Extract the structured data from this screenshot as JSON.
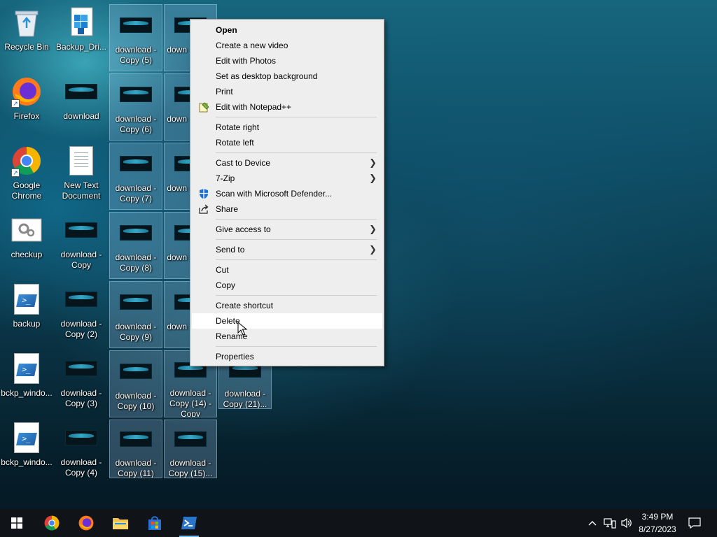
{
  "desktop": {
    "icons": [
      {
        "id": "recycle",
        "label": "Recycle Bin"
      },
      {
        "id": "backup_dr",
        "label": "Backup_Dri..."
      },
      {
        "id": "firefox",
        "label": "Firefox"
      },
      {
        "id": "download",
        "label": "download"
      },
      {
        "id": "chrome",
        "label": "Google Chrome"
      },
      {
        "id": "newtext",
        "label": "New Text Document"
      },
      {
        "id": "checkup",
        "label": "checkup"
      },
      {
        "id": "dlcopy",
        "label": "download - Copy"
      },
      {
        "id": "backup",
        "label": "backup"
      },
      {
        "id": "dlcopy2",
        "label": "download - Copy (2)"
      },
      {
        "id": "bckp1",
        "label": "bckp_windo..."
      },
      {
        "id": "dlcopy3",
        "label": "download - Copy (3)"
      },
      {
        "id": "bckp2",
        "label": "bckp_windo..."
      },
      {
        "id": "dlcopy4",
        "label": "download - Copy (4)"
      },
      {
        "id": "dlcopy5",
        "label": "download - Copy (5)"
      },
      {
        "id": "dlcopy6",
        "label": "download - Copy (6)"
      },
      {
        "id": "dlcopy7",
        "label": "download - Copy (7)"
      },
      {
        "id": "dlcopy8",
        "label": "download - Copy (8)"
      },
      {
        "id": "dlcopy9",
        "label": "download - Copy (9)"
      },
      {
        "id": "dlcopy10",
        "label": "download - Copy (10)"
      },
      {
        "id": "dlcopy11",
        "label": "download - Copy (11)"
      },
      {
        "id": "c3r1",
        "label": "down - Copy"
      },
      {
        "id": "c3r2",
        "label": "down - Copy"
      },
      {
        "id": "c3r3",
        "label": "down - Copy"
      },
      {
        "id": "c3r4",
        "label": "down - Copy"
      },
      {
        "id": "c3r5",
        "label": "down - Copy"
      },
      {
        "id": "dlcopy14",
        "label": "download - Copy (14) - Copy"
      },
      {
        "id": "dlcopy15",
        "label": "download - Copy (15)..."
      },
      {
        "id": "dlcopy21",
        "label": "download - Copy (21)..."
      }
    ]
  },
  "context_menu": {
    "items": {
      "open": "Open",
      "create_video": "Create a new video",
      "edit_photos": "Edit with Photos",
      "set_background": "Set as desktop background",
      "print": "Print",
      "edit_notepad": "Edit with Notepad++",
      "rotate_right": "Rotate right",
      "rotate_left": "Rotate left",
      "cast": "Cast to Device",
      "zip": "7-Zip",
      "defender": "Scan with Microsoft Defender...",
      "share": "Share",
      "give_access": "Give access to",
      "send_to": "Send to",
      "cut": "Cut",
      "copy": "Copy",
      "create_shortcut": "Create shortcut",
      "delete": "Delete",
      "rename": "Rename",
      "properties": "Properties"
    },
    "highlighted": "Delete"
  },
  "taskbar": {
    "apps": [
      "start-icon",
      "chrome-icon",
      "firefox-icon",
      "file-explorer-icon",
      "store-icon",
      "powershell-icon"
    ],
    "active_app": "powershell-icon",
    "clock": {
      "time": "3:49 PM",
      "date": "8/27/2023"
    }
  }
}
